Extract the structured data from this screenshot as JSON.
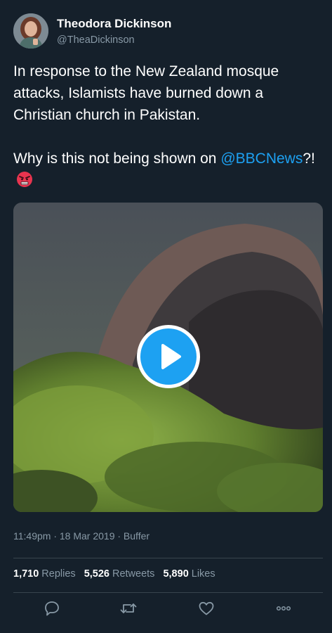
{
  "tweet": {
    "author": {
      "name": "Theodora Dickinson",
      "handle": "@TheaDickinson"
    },
    "text": {
      "line1": "In response to the New Zealand mosque attacks, Islamists have burned down a Christian church in Pakistan.",
      "line2_prefix": "Why is this not being shown on ",
      "mention": "@BBCNews",
      "line2_suffix": "?!",
      "emoji_icon": "angry-face-icon"
    },
    "media": {
      "type": "video",
      "play_icon": "play-icon"
    },
    "meta": "11:49pm · 18 Mar 2019 · Buffer",
    "stats": {
      "replies_count": "1,710",
      "replies_label": "Replies",
      "retweets_count": "5,526",
      "retweets_label": "Retweets",
      "likes_count": "5,890",
      "likes_label": "Likes"
    },
    "actions": [
      "reply-icon",
      "retweet-icon",
      "like-icon",
      "more-icon"
    ]
  },
  "colors": {
    "background": "#15202b",
    "accent": "#1da1f2",
    "secondary_text": "#8899a6",
    "divider": "#38444d"
  }
}
